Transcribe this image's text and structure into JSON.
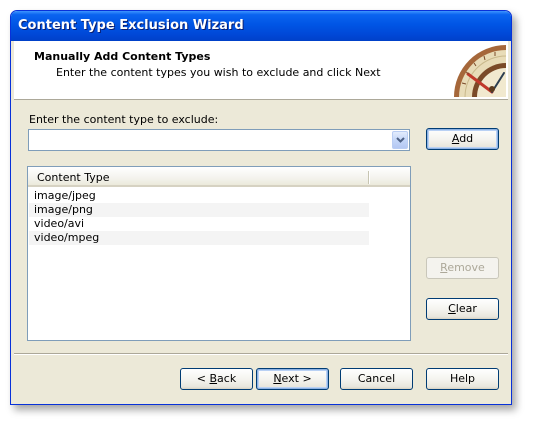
{
  "window": {
    "title": "Content Type Exclusion Wizard"
  },
  "header": {
    "title": "Manually Add Content Types",
    "subtitle": "Enter the content types you wish to exclude and click Next",
    "graphic_icon": "compass-icon"
  },
  "form": {
    "label": "Enter the content type to exclude:",
    "input_value": "",
    "dropdown_icon": "chevron-down-icon"
  },
  "list": {
    "column_header": "Content Type",
    "items": [
      "image/jpeg",
      "image/png",
      "video/avi",
      "video/mpeg"
    ]
  },
  "buttons": {
    "add": {
      "pre": "",
      "key": "A",
      "post": "dd"
    },
    "remove": {
      "pre": "",
      "key": "R",
      "post": "emove"
    },
    "clear": {
      "pre": "",
      "key": "C",
      "post": "lear"
    },
    "back": {
      "pre": "< ",
      "key": "B",
      "post": "ack"
    },
    "next": {
      "pre": "",
      "key": "N",
      "post": "ext >"
    },
    "cancel": "Cancel",
    "help": "Help"
  },
  "colors": {
    "title_bar": "#0055e5",
    "dialog_background": "#ece9d8",
    "header_background": "#ffffff",
    "disabled_text": "#aca899"
  }
}
